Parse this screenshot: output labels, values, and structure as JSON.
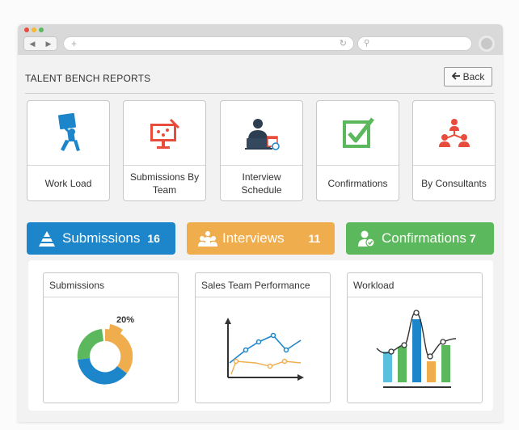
{
  "browser": {
    "url_placeholder": "+",
    "nav_back": "◀",
    "nav_forward": "▶",
    "reload_glyph": "↻",
    "search_glyph": "⚲"
  },
  "header": {
    "title": "TALENT BENCH REPORTS",
    "back_label": "Back",
    "back_arrow": "🡐"
  },
  "tiles": [
    {
      "label": "Work Load",
      "icon": "worker-carrying-box-icon"
    },
    {
      "label": "Submissions By Team",
      "icon": "monitor-presentation-icon"
    },
    {
      "label": "Interview Schedule",
      "icon": "person-laptop-calendar-icon"
    },
    {
      "label": "Confirmations",
      "icon": "checkbox-icon"
    },
    {
      "label": "By Consultants",
      "icon": "team-hierarchy-icon"
    }
  ],
  "stats": [
    {
      "label": "Submissions",
      "count": "16",
      "color": "#1d86cb",
      "icon": "pyramid-icon"
    },
    {
      "label": "Interviews",
      "count": "11",
      "color": "#f0ad4e",
      "icon": "people-group-icon"
    },
    {
      "label": "Confirmations",
      "count": "7",
      "color": "#5cb85c",
      "icon": "user-check-icon"
    }
  ],
  "charts": [
    {
      "title": "Submissions",
      "callout": "20%",
      "colors": [
        "#1d86cb",
        "#f0ad4e",
        "#5cb85c"
      ]
    },
    {
      "title": "Sales Team Performance",
      "colors": [
        "#1d86cb",
        "#f0ad4e"
      ]
    },
    {
      "title": "Workload",
      "colors": [
        "#5bc0de",
        "#5cb85c",
        "#1d86cb",
        "#f0ad4e"
      ]
    }
  ]
}
